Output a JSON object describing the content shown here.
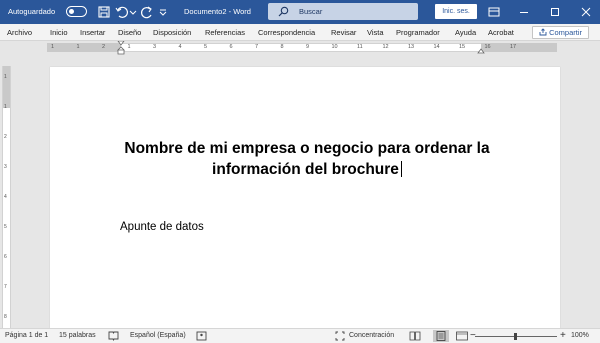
{
  "titlebar": {
    "autosave_label": "Autoguardado",
    "doc_title": "Documento2 - Word",
    "search_placeholder": "Buscar",
    "signin_label": "Inic. ses.",
    "accent": "#2b579a"
  },
  "menu": {
    "items": [
      "Archivo",
      "Inicio",
      "Insertar",
      "Diseño",
      "Disposición",
      "Referencias",
      "Correspondencia",
      "Revisar",
      "Vista",
      "Programador",
      "Ayuda",
      "Acrobat"
    ],
    "share_label": "Compartir"
  },
  "ruler": {
    "h_ticks": [
      "1",
      "1",
      "2",
      "1",
      "3",
      "4",
      "5",
      "6",
      "7",
      "8",
      "9",
      "10",
      "11",
      "12",
      "13",
      "14",
      "15",
      "16",
      "17"
    ],
    "v_ticks": [
      "1",
      "1",
      "2",
      "3",
      "4",
      "5",
      "6",
      "7",
      "8"
    ]
  },
  "document": {
    "heading": "Nombre de mi empresa o negocio para ordenar la información del brochure",
    "body": "Apunte de datos"
  },
  "status": {
    "page": "Página 1 de 1",
    "words": "15 palabras",
    "language": "Español (España)",
    "focus": "Concentración",
    "zoom": "100%",
    "zoom_minus": "−",
    "zoom_plus": "+"
  }
}
